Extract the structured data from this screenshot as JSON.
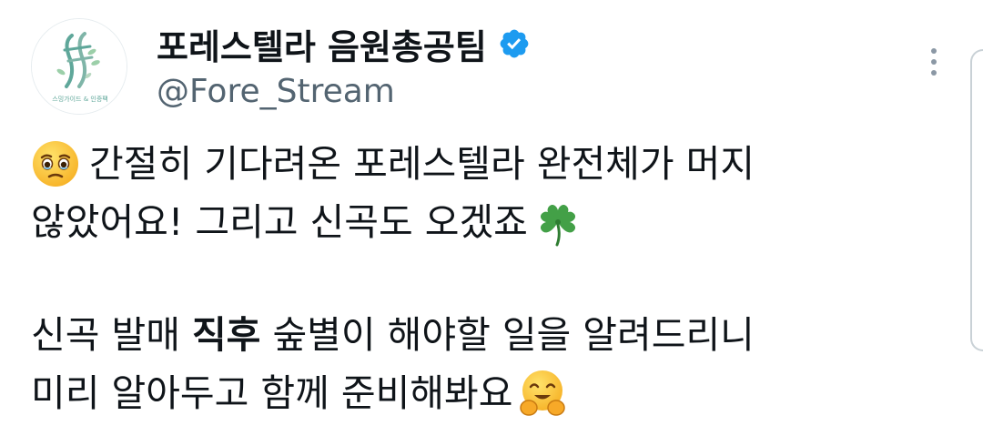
{
  "author": {
    "display_name": "포레스텔라 음원총공팀",
    "handle": "@Fore_Stream",
    "verified": true,
    "avatar_caption": "스밍가이드 & 인증팩"
  },
  "tweet": {
    "line1": "간절히 기다려온 포레스텔라 완전체가 머지",
    "line2": "않았어요! 그리고 신곡도 오겠죠",
    "line3_a": "신곡 발매 ",
    "line3_bold": "직후",
    "line3_b": " 숲별이 해야할 일을 알려드리니",
    "line4": "미리 알아두고 함께 준비해봐요",
    "emojis": [
      "face-holding-back-tears-emoji",
      "four-leaf-clover-emoji",
      "hugging-face-emoji"
    ]
  },
  "colors": {
    "text": "#0f1419",
    "secondary": "#536471",
    "verified_blue": "#1d9bf0",
    "logo_teal": "#5fa79a"
  }
}
